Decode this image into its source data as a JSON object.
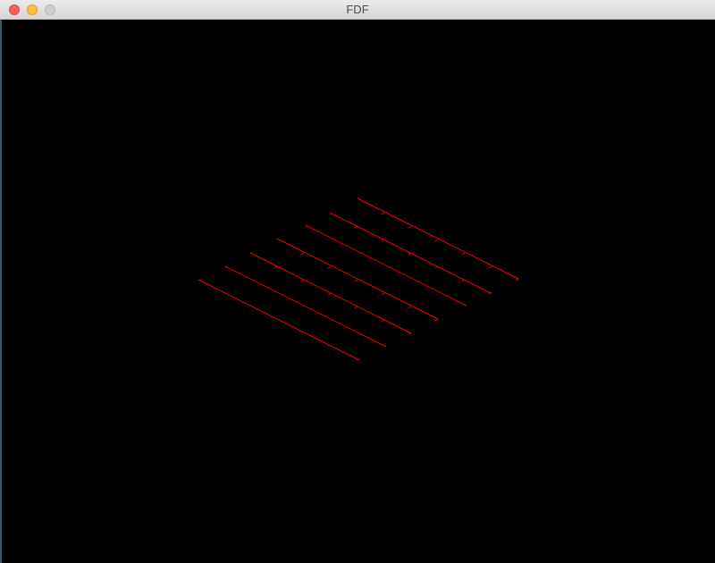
{
  "window": {
    "title": "FDF"
  },
  "colors": {
    "background": "#000000",
    "line": "#ff0000"
  }
}
